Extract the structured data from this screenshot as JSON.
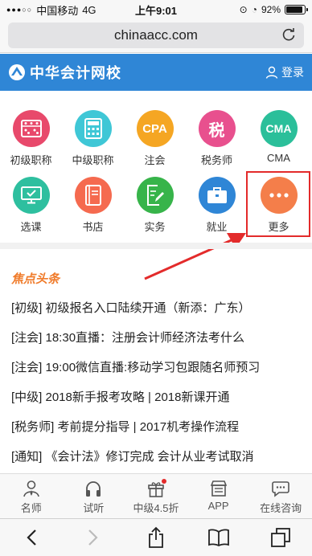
{
  "status": {
    "carrier": "中国移动",
    "network": "4G",
    "time": "上午9:01",
    "battery": "92%",
    "battery_level": 0.92
  },
  "browser": {
    "url": "chinaacc.com"
  },
  "header": {
    "site_title": "中华会计网校",
    "login_label": "登录",
    "color": "#2f86d6"
  },
  "grid": {
    "items": [
      {
        "label": "初级职称",
        "icon": "abacus-icon",
        "color": "#e8496b"
      },
      {
        "label": "中级职称",
        "icon": "calculator-icon",
        "color": "#3fc7d6"
      },
      {
        "label": "注会",
        "icon": "cpa-icon",
        "icon_text": "CPA",
        "color": "#f5a623"
      },
      {
        "label": "税务师",
        "icon": "tax-icon",
        "icon_text": "税",
        "color": "#e8508e"
      },
      {
        "label": "CMA",
        "icon": "cma-icon",
        "icon_text": "CMA",
        "color": "#2bbf9a"
      },
      {
        "label": "选课",
        "icon": "monitor-check-icon",
        "color": "#2ebf9f"
      },
      {
        "label": "书店",
        "icon": "book-icon",
        "color": "#f56a4f"
      },
      {
        "label": "实务",
        "icon": "document-edit-icon",
        "color": "#37b44a"
      },
      {
        "label": "就业",
        "icon": "briefcase-icon",
        "color": "#2f86d6"
      },
      {
        "label": "更多",
        "icon": "more-dots-icon",
        "color": "#f47e4a"
      }
    ]
  },
  "news": {
    "title": "焦点头条",
    "items": [
      "[初级] 初级报名入口陆续开通（新添：广东）",
      "[注会] 18:30直播：注册会计师经济法考什么",
      "[注会] 19:00微信直播:移动学习包跟随名师预习",
      "[中级] 2018新手报考攻略 | 2018新课开通",
      "[税务师] 考前提分指导 | 2017机考操作流程",
      "[通知] 《会计法》修订完成 会计从业考试取消"
    ]
  },
  "tabbar": {
    "items": [
      {
        "label": "名师",
        "icon": "teacher-icon"
      },
      {
        "label": "试听",
        "icon": "headphones-icon"
      },
      {
        "label": "中级4.5折",
        "icon": "gift-icon"
      },
      {
        "label": "APP",
        "icon": "app-store-icon"
      },
      {
        "label": "在线咨询",
        "icon": "chat-bubble-icon"
      }
    ]
  }
}
